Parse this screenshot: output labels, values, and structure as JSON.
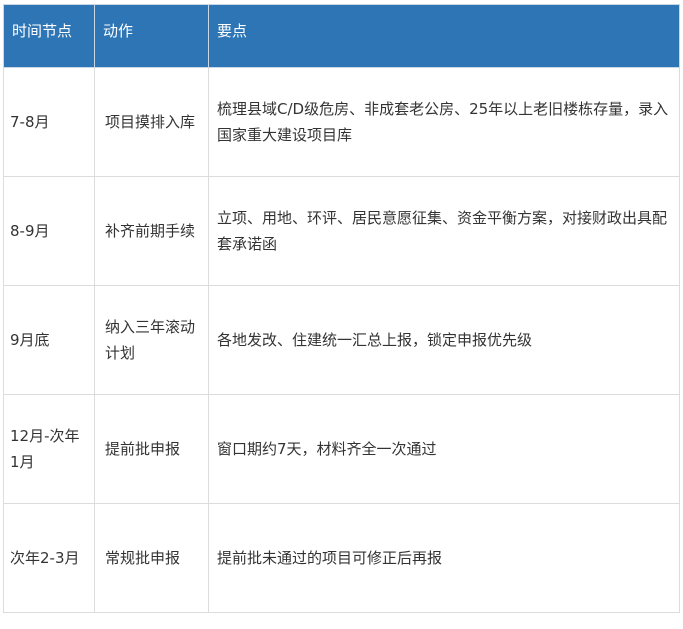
{
  "table": {
    "headers": [
      "时间节点",
      "动作",
      "要点"
    ],
    "rows": [
      {
        "time": "7-8月",
        "action": "项目摸排入库",
        "points": "梳理县域C/D级危房、非成套老公房、25年以上老旧楼栋存量，录入国家重大建设项目库"
      },
      {
        "time": "8-9月",
        "action": "补齐前期手续",
        "points": "立项、用地、环评、居民意愿征集、资金平衡方案，对接财政出具配套承诺函"
      },
      {
        "time": "9月底",
        "action": "纳入三年滚动计划",
        "points": "各地发改、住建统一汇总上报，锁定申报优先级"
      },
      {
        "time": "12月-次年1月",
        "action": "提前批申报",
        "points": "窗口期约7天，材料齐全一次通过"
      },
      {
        "time": "次年2-3月",
        "action": "常规批申报",
        "points": "提前批未通过的项目可修正后再报"
      }
    ]
  }
}
